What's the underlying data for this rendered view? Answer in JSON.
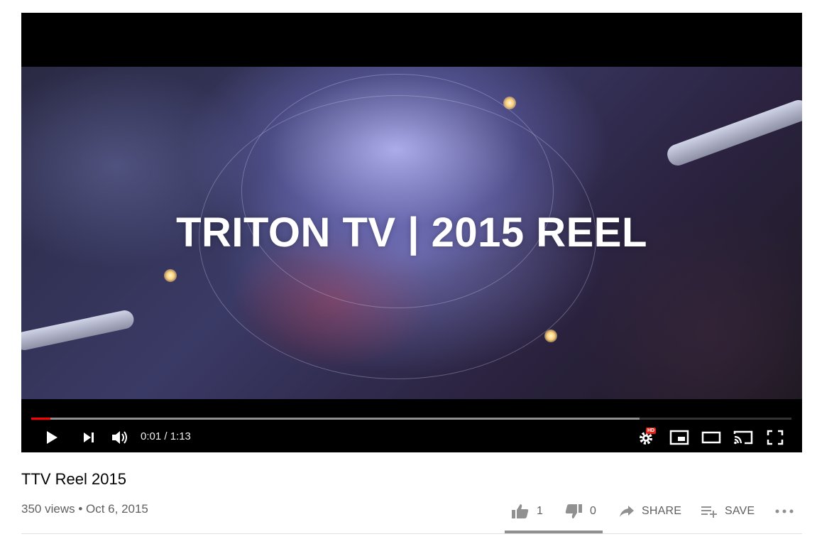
{
  "player": {
    "overlay_title": "TRITON TV | 2015 REEL",
    "time_display": "0:01 / 1:13",
    "progress_fraction": 0.025,
    "buffered_fraction": 0.8,
    "hd_badge": "HD"
  },
  "video": {
    "title": "TTV Reel 2015",
    "meta": "350 views • Oct 6, 2015"
  },
  "actions": {
    "likes": "1",
    "dislikes": "0",
    "share_label": "SHARE",
    "save_label": "SAVE"
  },
  "colors": {
    "progress_played": "#ff0000",
    "hd_badge": "#e62117"
  }
}
